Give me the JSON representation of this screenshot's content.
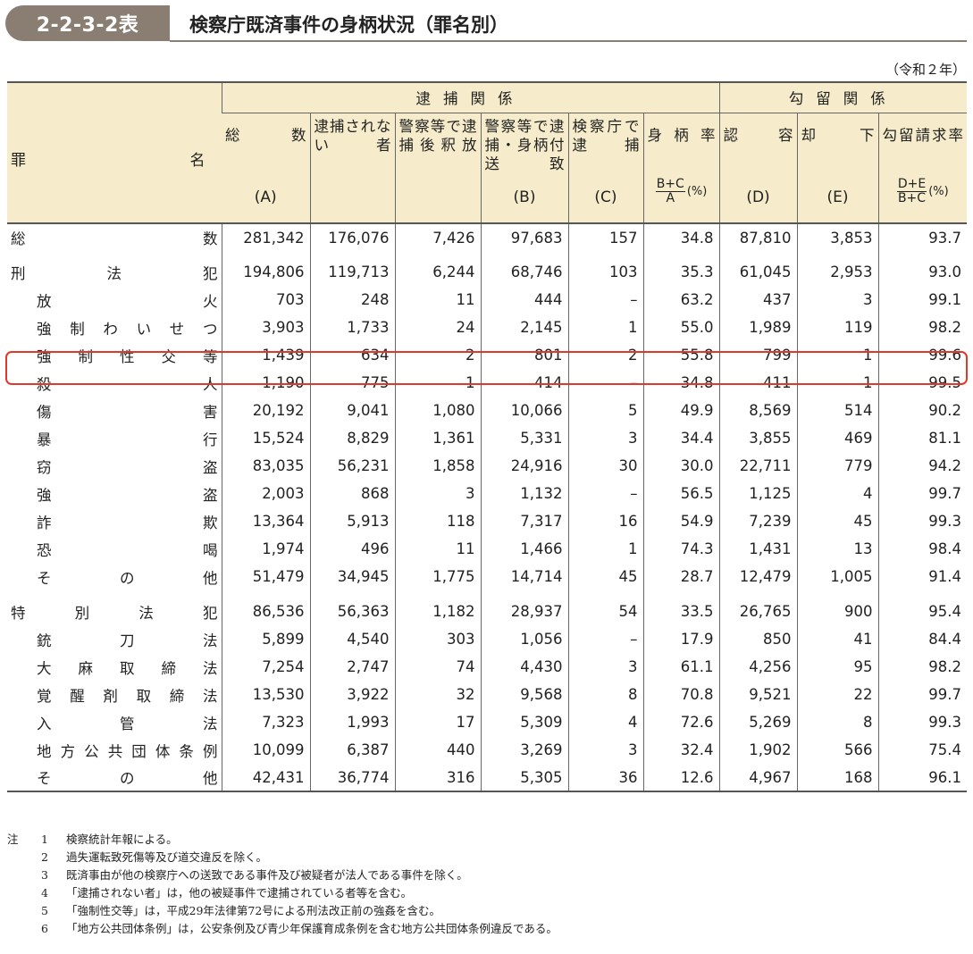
{
  "title": {
    "tag": "2-2-3-2表",
    "text": "検察庁既済事件の身柄状況（罪名別）"
  },
  "year_note": "（令和２年）",
  "headers": {
    "name": [
      "罪",
      "名"
    ],
    "group_arrest": "逮捕関係",
    "group_detention": "勾留関係",
    "cols": [
      {
        "label": "総 数",
        "code": "(A)"
      },
      {
        "label": "逮捕されない者",
        "code": ""
      },
      {
        "label": "警察等で逮捕後釈放",
        "code": ""
      },
      {
        "label": "警察等で逮捕・身柄付送致",
        "code": "(B)"
      },
      {
        "label": "検察庁で逮捕",
        "code": "(C)"
      },
      {
        "label": "身柄率",
        "formula_num": "B+C",
        "formula_den": "A",
        "unit": "(%)"
      },
      {
        "label": "認 容",
        "code": "(D)"
      },
      {
        "label": "却 下",
        "code": "(E)"
      },
      {
        "label": "勾留請求率",
        "formula_num": "D+E",
        "formula_den": "B+C",
        "unit": "(%)"
      }
    ]
  },
  "rows": [
    {
      "name": "総数",
      "indent": false,
      "values": [
        "281,342",
        "176,076",
        "7,426",
        "97,683",
        "157",
        "34.8",
        "87,810",
        "3,853",
        "93.7"
      ]
    },
    {
      "gap": true
    },
    {
      "name": "刑法犯",
      "indent": false,
      "values": [
        "194,806",
        "119,713",
        "6,244",
        "68,746",
        "103",
        "35.3",
        "61,045",
        "2,953",
        "93.0"
      ]
    },
    {
      "name": "放火",
      "indent": true,
      "values": [
        "703",
        "248",
        "11",
        "444",
        "–",
        "63.2",
        "437",
        "3",
        "99.1"
      ]
    },
    {
      "name": "強制わいせつ",
      "indent": true,
      "values": [
        "3,903",
        "1,733",
        "24",
        "2,145",
        "1",
        "55.0",
        "1,989",
        "119",
        "98.2"
      ]
    },
    {
      "name": "強制性交等",
      "indent": true,
      "highlight": true,
      "values": [
        "1,439",
        "634",
        "2",
        "801",
        "2",
        "55.8",
        "799",
        "1",
        "99.6"
      ]
    },
    {
      "name": "殺人",
      "indent": true,
      "values": [
        "1,190",
        "775",
        "1",
        "414",
        "–",
        "34.8",
        "411",
        "1",
        "99.5"
      ]
    },
    {
      "name": "傷害",
      "indent": true,
      "values": [
        "20,192",
        "9,041",
        "1,080",
        "10,066",
        "5",
        "49.9",
        "8,569",
        "514",
        "90.2"
      ]
    },
    {
      "name": "暴行",
      "indent": true,
      "values": [
        "15,524",
        "8,829",
        "1,361",
        "5,331",
        "3",
        "34.4",
        "3,855",
        "469",
        "81.1"
      ]
    },
    {
      "name": "窃盗",
      "indent": true,
      "values": [
        "83,035",
        "56,231",
        "1,858",
        "24,916",
        "30",
        "30.0",
        "22,711",
        "779",
        "94.2"
      ]
    },
    {
      "name": "強盗",
      "indent": true,
      "values": [
        "2,003",
        "868",
        "3",
        "1,132",
        "–",
        "56.5",
        "1,125",
        "4",
        "99.7"
      ]
    },
    {
      "name": "詐欺",
      "indent": true,
      "values": [
        "13,364",
        "5,913",
        "118",
        "7,317",
        "16",
        "54.9",
        "7,239",
        "45",
        "99.3"
      ]
    },
    {
      "name": "恐喝",
      "indent": true,
      "values": [
        "1,974",
        "496",
        "11",
        "1,466",
        "1",
        "74.3",
        "1,431",
        "13",
        "98.4"
      ]
    },
    {
      "name": "その他",
      "indent": true,
      "values": [
        "51,479",
        "34,945",
        "1,775",
        "14,714",
        "45",
        "28.7",
        "12,479",
        "1,005",
        "91.4"
      ]
    },
    {
      "gap": true
    },
    {
      "name": "特別法犯",
      "indent": false,
      "values": [
        "86,536",
        "56,363",
        "1,182",
        "28,937",
        "54",
        "33.5",
        "26,765",
        "900",
        "95.4"
      ]
    },
    {
      "name": "銃刀法",
      "indent": true,
      "values": [
        "5,899",
        "4,540",
        "303",
        "1,056",
        "–",
        "17.9",
        "850",
        "41",
        "84.4"
      ]
    },
    {
      "name": "大麻取締法",
      "indent": true,
      "values": [
        "7,254",
        "2,747",
        "74",
        "4,430",
        "3",
        "61.1",
        "4,256",
        "95",
        "98.2"
      ]
    },
    {
      "name": "覚醒剤取締法",
      "indent": true,
      "values": [
        "13,530",
        "3,922",
        "32",
        "9,568",
        "8",
        "70.8",
        "9,521",
        "22",
        "99.7"
      ]
    },
    {
      "name": "入管法",
      "indent": true,
      "values": [
        "7,323",
        "1,993",
        "17",
        "5,309",
        "4",
        "72.6",
        "5,269",
        "8",
        "99.3"
      ]
    },
    {
      "name": "地方公共団体条例",
      "indent": true,
      "values": [
        "10,099",
        "6,387",
        "440",
        "3,269",
        "3",
        "32.4",
        "1,902",
        "566",
        "75.4"
      ]
    },
    {
      "name": "その他",
      "indent": true,
      "values": [
        "42,431",
        "36,774",
        "316",
        "5,305",
        "36",
        "12.6",
        "4,967",
        "168",
        "96.1"
      ]
    }
  ],
  "notes": {
    "lead": "注",
    "items": [
      {
        "num": "1",
        "text": "検察統計年報による。"
      },
      {
        "num": "2",
        "text": "過失運転致死傷等及び道交違反を除く。"
      },
      {
        "num": "3",
        "text": "既済事由が他の検察庁への送致である事件及び被疑者が法人である事件を除く。"
      },
      {
        "num": "4",
        "text": "「逮捕されない者」は，他の被疑事件で逮捕されている者等を含む。"
      },
      {
        "num": "5",
        "text": "「強制性交等」は，平成29年法律第72号による刑法改正前の強姦を含む。"
      },
      {
        "num": "6",
        "text": "「地方公共団体条例」は，公安条例及び青少年保護育成条例を含む地方公共団体条例違反である。"
      }
    ]
  },
  "colors": {
    "header_bg": "#f6eccb",
    "title_tag_bg": "#8a7d72",
    "highlight_border": "#e0382a"
  }
}
